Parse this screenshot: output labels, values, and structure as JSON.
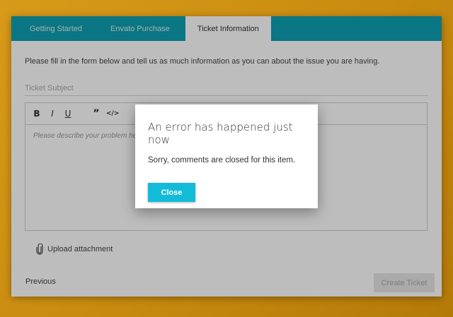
{
  "tabs": [
    {
      "label": "Getting Started"
    },
    {
      "label": "Envato Purchase"
    },
    {
      "label": "Ticket Information"
    }
  ],
  "form": {
    "intro": "Please fill in the form below and tell us as much information as you can about the issue you are having.",
    "subject_placeholder": "Ticket Subject",
    "editor_placeholder": "Please describe your problem he",
    "toolbar": {
      "bold": "B",
      "italic": "I",
      "underline": "U",
      "quote": "”",
      "code": "</>"
    },
    "upload_label": "Upload attachment",
    "previous_label": "Previous",
    "create_label": "Create Ticket"
  },
  "modal": {
    "title": "An error has happened just now",
    "message": "Sorry, comments are closed for this item.",
    "close_label": "Close"
  },
  "colors": {
    "tab_bar": "#0f9fb2",
    "close_button": "#12bcd8",
    "background": "#d99a1a"
  }
}
